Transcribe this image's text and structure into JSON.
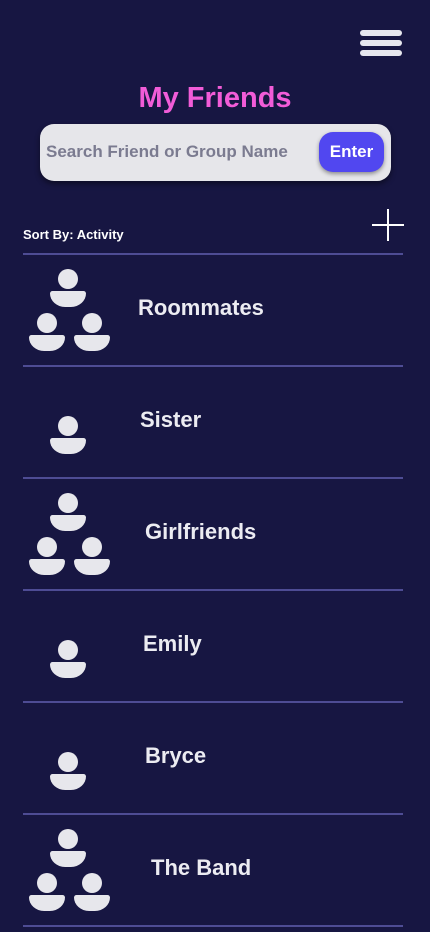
{
  "header": {
    "title": "My Friends",
    "menu_icon": "hamburger-menu-icon"
  },
  "search": {
    "placeholder": "Search Friend or Group Name",
    "value": "",
    "button_label": "Enter"
  },
  "sort": {
    "label": "Sort By: Activity"
  },
  "add_icon": "plus-icon",
  "friends": [
    {
      "name": "Roommates",
      "type": "group",
      "icon": "group-icon"
    },
    {
      "name": "Sister",
      "type": "person",
      "icon": "person-icon"
    },
    {
      "name": "Girlfriends",
      "type": "group",
      "icon": "group-icon"
    },
    {
      "name": "Emily",
      "type": "person",
      "icon": "person-icon"
    },
    {
      "name": "Bryce",
      "type": "person",
      "icon": "person-icon"
    },
    {
      "name": "The Band",
      "type": "group",
      "icon": "group-icon"
    }
  ],
  "colors": {
    "background": "#171642",
    "title": "#f25cd8",
    "accent_button": "#5147f0",
    "divider": "#4e4c94",
    "icon_fill": "#e7e7ec"
  }
}
